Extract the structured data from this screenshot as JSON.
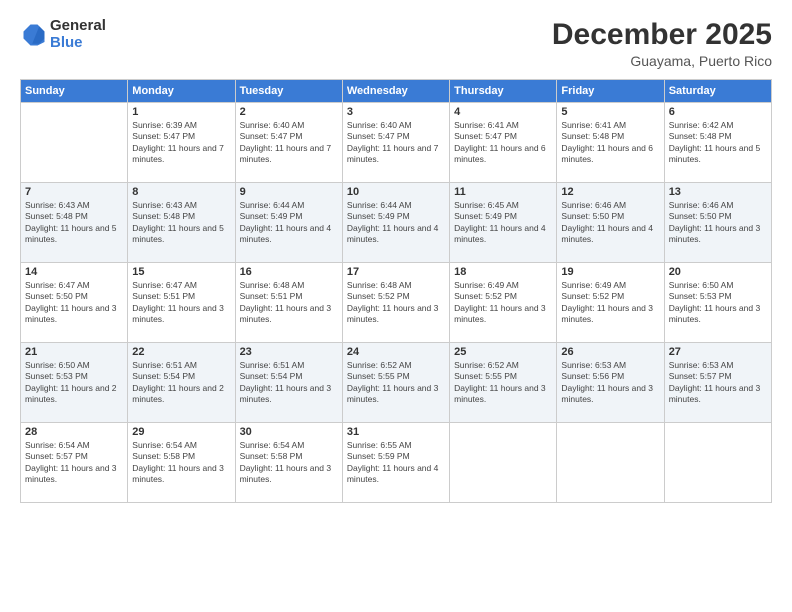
{
  "header": {
    "logo": {
      "general": "General",
      "blue": "Blue"
    },
    "title": "December 2025",
    "location": "Guayama, Puerto Rico"
  },
  "calendar": {
    "days_of_week": [
      "Sunday",
      "Monday",
      "Tuesday",
      "Wednesday",
      "Thursday",
      "Friday",
      "Saturday"
    ],
    "weeks": [
      [
        {
          "num": "",
          "sunrise": "",
          "sunset": "",
          "daylight": "",
          "empty": true
        },
        {
          "num": "1",
          "sunrise": "Sunrise: 6:39 AM",
          "sunset": "Sunset: 5:47 PM",
          "daylight": "Daylight: 11 hours and 7 minutes."
        },
        {
          "num": "2",
          "sunrise": "Sunrise: 6:40 AM",
          "sunset": "Sunset: 5:47 PM",
          "daylight": "Daylight: 11 hours and 7 minutes."
        },
        {
          "num": "3",
          "sunrise": "Sunrise: 6:40 AM",
          "sunset": "Sunset: 5:47 PM",
          "daylight": "Daylight: 11 hours and 7 minutes."
        },
        {
          "num": "4",
          "sunrise": "Sunrise: 6:41 AM",
          "sunset": "Sunset: 5:47 PM",
          "daylight": "Daylight: 11 hours and 6 minutes."
        },
        {
          "num": "5",
          "sunrise": "Sunrise: 6:41 AM",
          "sunset": "Sunset: 5:48 PM",
          "daylight": "Daylight: 11 hours and 6 minutes."
        },
        {
          "num": "6",
          "sunrise": "Sunrise: 6:42 AM",
          "sunset": "Sunset: 5:48 PM",
          "daylight": "Daylight: 11 hours and 5 minutes."
        }
      ],
      [
        {
          "num": "7",
          "sunrise": "Sunrise: 6:43 AM",
          "sunset": "Sunset: 5:48 PM",
          "daylight": "Daylight: 11 hours and 5 minutes."
        },
        {
          "num": "8",
          "sunrise": "Sunrise: 6:43 AM",
          "sunset": "Sunset: 5:48 PM",
          "daylight": "Daylight: 11 hours and 5 minutes."
        },
        {
          "num": "9",
          "sunrise": "Sunrise: 6:44 AM",
          "sunset": "Sunset: 5:49 PM",
          "daylight": "Daylight: 11 hours and 4 minutes."
        },
        {
          "num": "10",
          "sunrise": "Sunrise: 6:44 AM",
          "sunset": "Sunset: 5:49 PM",
          "daylight": "Daylight: 11 hours and 4 minutes."
        },
        {
          "num": "11",
          "sunrise": "Sunrise: 6:45 AM",
          "sunset": "Sunset: 5:49 PM",
          "daylight": "Daylight: 11 hours and 4 minutes."
        },
        {
          "num": "12",
          "sunrise": "Sunrise: 6:46 AM",
          "sunset": "Sunset: 5:50 PM",
          "daylight": "Daylight: 11 hours and 4 minutes."
        },
        {
          "num": "13",
          "sunrise": "Sunrise: 6:46 AM",
          "sunset": "Sunset: 5:50 PM",
          "daylight": "Daylight: 11 hours and 3 minutes."
        }
      ],
      [
        {
          "num": "14",
          "sunrise": "Sunrise: 6:47 AM",
          "sunset": "Sunset: 5:50 PM",
          "daylight": "Daylight: 11 hours and 3 minutes."
        },
        {
          "num": "15",
          "sunrise": "Sunrise: 6:47 AM",
          "sunset": "Sunset: 5:51 PM",
          "daylight": "Daylight: 11 hours and 3 minutes."
        },
        {
          "num": "16",
          "sunrise": "Sunrise: 6:48 AM",
          "sunset": "Sunset: 5:51 PM",
          "daylight": "Daylight: 11 hours and 3 minutes."
        },
        {
          "num": "17",
          "sunrise": "Sunrise: 6:48 AM",
          "sunset": "Sunset: 5:52 PM",
          "daylight": "Daylight: 11 hours and 3 minutes."
        },
        {
          "num": "18",
          "sunrise": "Sunrise: 6:49 AM",
          "sunset": "Sunset: 5:52 PM",
          "daylight": "Daylight: 11 hours and 3 minutes."
        },
        {
          "num": "19",
          "sunrise": "Sunrise: 6:49 AM",
          "sunset": "Sunset: 5:52 PM",
          "daylight": "Daylight: 11 hours and 3 minutes."
        },
        {
          "num": "20",
          "sunrise": "Sunrise: 6:50 AM",
          "sunset": "Sunset: 5:53 PM",
          "daylight": "Daylight: 11 hours and 3 minutes."
        }
      ],
      [
        {
          "num": "21",
          "sunrise": "Sunrise: 6:50 AM",
          "sunset": "Sunset: 5:53 PM",
          "daylight": "Daylight: 11 hours and 2 minutes."
        },
        {
          "num": "22",
          "sunrise": "Sunrise: 6:51 AM",
          "sunset": "Sunset: 5:54 PM",
          "daylight": "Daylight: 11 hours and 2 minutes."
        },
        {
          "num": "23",
          "sunrise": "Sunrise: 6:51 AM",
          "sunset": "Sunset: 5:54 PM",
          "daylight": "Daylight: 11 hours and 3 minutes."
        },
        {
          "num": "24",
          "sunrise": "Sunrise: 6:52 AM",
          "sunset": "Sunset: 5:55 PM",
          "daylight": "Daylight: 11 hours and 3 minutes."
        },
        {
          "num": "25",
          "sunrise": "Sunrise: 6:52 AM",
          "sunset": "Sunset: 5:55 PM",
          "daylight": "Daylight: 11 hours and 3 minutes."
        },
        {
          "num": "26",
          "sunrise": "Sunrise: 6:53 AM",
          "sunset": "Sunset: 5:56 PM",
          "daylight": "Daylight: 11 hours and 3 minutes."
        },
        {
          "num": "27",
          "sunrise": "Sunrise: 6:53 AM",
          "sunset": "Sunset: 5:57 PM",
          "daylight": "Daylight: 11 hours and 3 minutes."
        }
      ],
      [
        {
          "num": "28",
          "sunrise": "Sunrise: 6:54 AM",
          "sunset": "Sunset: 5:57 PM",
          "daylight": "Daylight: 11 hours and 3 minutes."
        },
        {
          "num": "29",
          "sunrise": "Sunrise: 6:54 AM",
          "sunset": "Sunset: 5:58 PM",
          "daylight": "Daylight: 11 hours and 3 minutes."
        },
        {
          "num": "30",
          "sunrise": "Sunrise: 6:54 AM",
          "sunset": "Sunset: 5:58 PM",
          "daylight": "Daylight: 11 hours and 3 minutes."
        },
        {
          "num": "31",
          "sunrise": "Sunrise: 6:55 AM",
          "sunset": "Sunset: 5:59 PM",
          "daylight": "Daylight: 11 hours and 4 minutes."
        },
        {
          "num": "",
          "sunrise": "",
          "sunset": "",
          "daylight": "",
          "empty": true
        },
        {
          "num": "",
          "sunrise": "",
          "sunset": "",
          "daylight": "",
          "empty": true
        },
        {
          "num": "",
          "sunrise": "",
          "sunset": "",
          "daylight": "",
          "empty": true
        }
      ]
    ]
  }
}
